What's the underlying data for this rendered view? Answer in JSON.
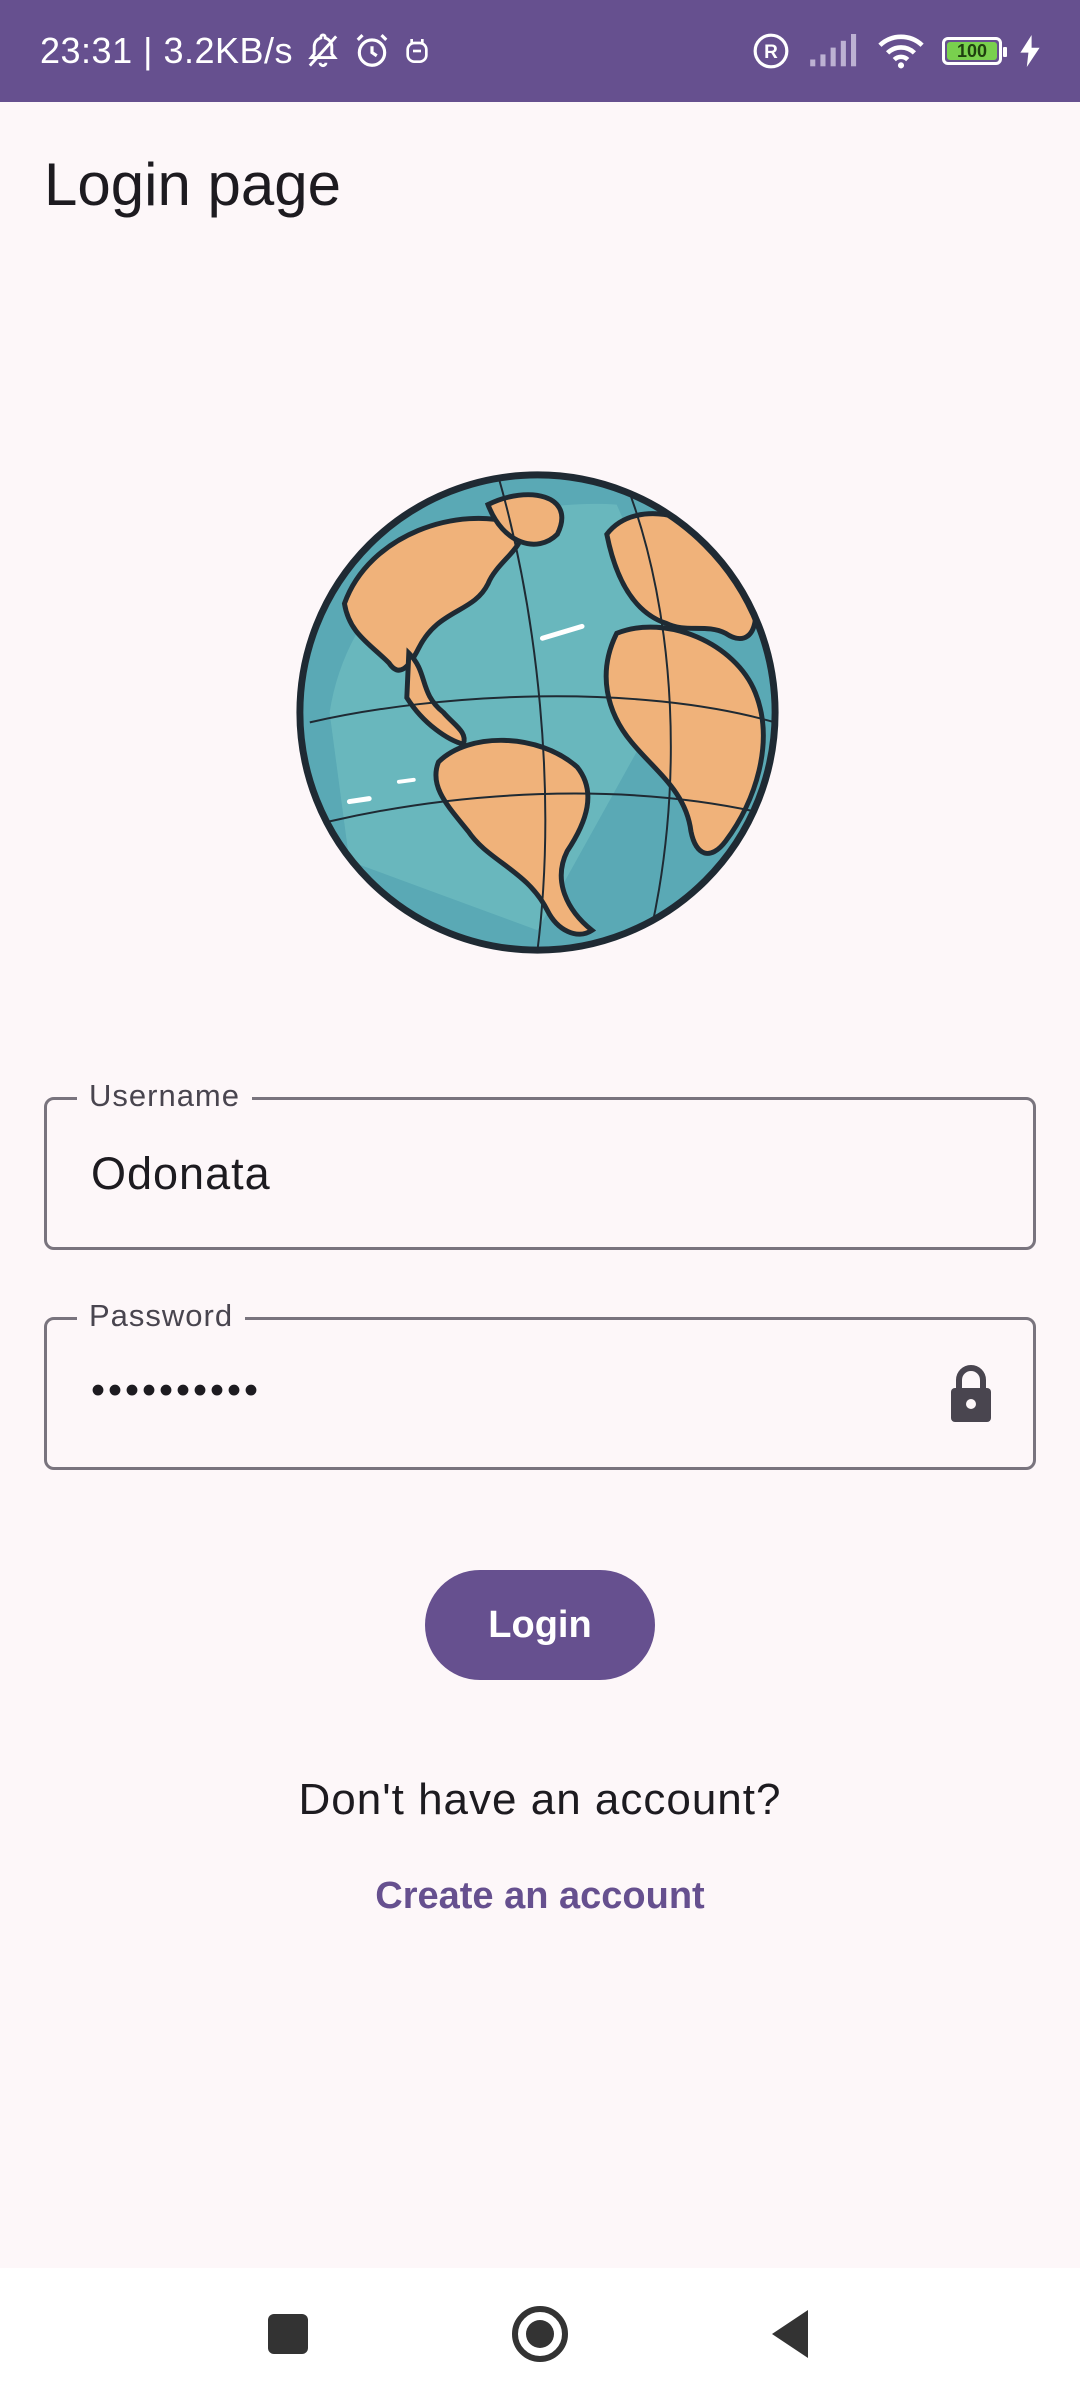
{
  "status_bar": {
    "time_speed": "23:31 | 3.2KB/s",
    "battery_level": "100",
    "icons": [
      "bell-off-icon",
      "alarm-icon",
      "notification-icon",
      "registered-icon",
      "signal-icon",
      "wifi-icon",
      "battery-icon",
      "charging-icon"
    ]
  },
  "header": {
    "title": "Login page"
  },
  "logo": {
    "icon": "globe-icon"
  },
  "form": {
    "username": {
      "label": "Username",
      "value": "Odonata"
    },
    "password": {
      "label": "Password",
      "value": "••••••••••",
      "icon": "lock-icon"
    },
    "login_label": "Login"
  },
  "footer": {
    "prompt": "Don't have an account?",
    "create_link": "Create an account"
  },
  "nav_bar": {
    "icons": [
      "recents-icon",
      "home-icon",
      "back-icon"
    ]
  },
  "colors": {
    "primary": "#66508f",
    "background": "#fdf7f9",
    "outline": "#79747e",
    "text": "#1d1b20"
  }
}
